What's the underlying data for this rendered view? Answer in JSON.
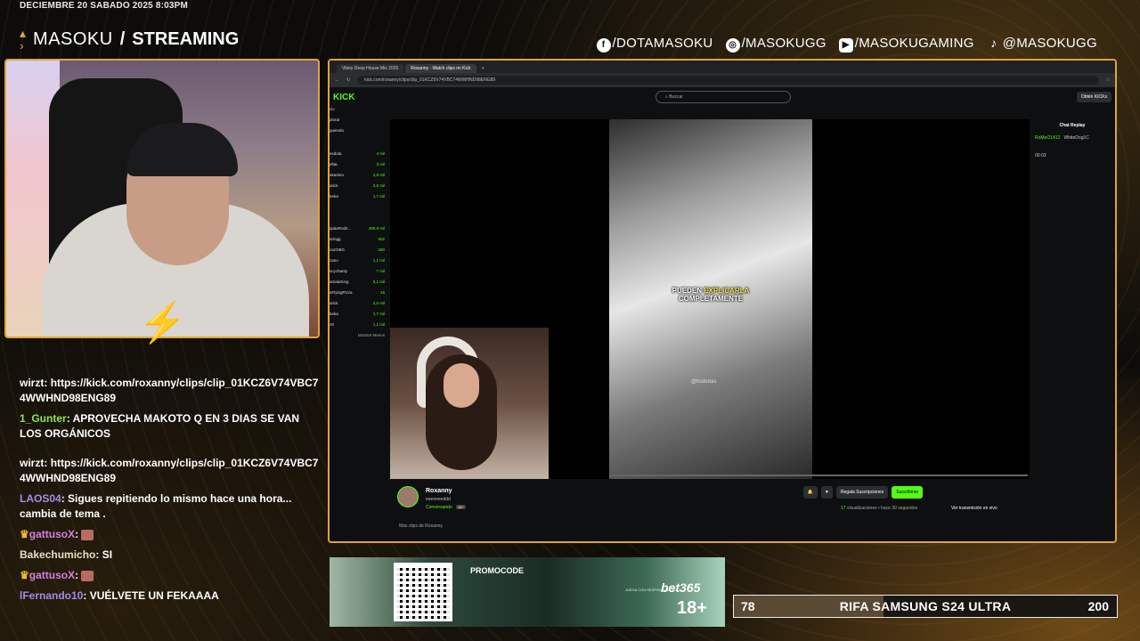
{
  "overlay": {
    "datetime": "DECIEMBRE 20 SABADO 2025 8:03PM",
    "brand_name": "MASOKU",
    "brand_sep": "/",
    "brand_tag": "STREAMING",
    "socials": [
      {
        "icon": "facebook-icon",
        "handle": "/DOTAMASOKU"
      },
      {
        "icon": "instagram-icon",
        "handle": "/MASOKUGG"
      },
      {
        "icon": "youtube-icon",
        "handle": "/MASOKUGAMING"
      },
      {
        "icon": "tiktok-icon",
        "handle": "@MASOKUGG"
      }
    ],
    "accent": "#e0a33a"
  },
  "chat": [
    {
      "user": "wirzt",
      "text": "https://kick.com/roxanny/clips/clip_01KCZ6V74VBC74WWHND98ENG89",
      "color": "#ffffff"
    },
    {
      "user": "1_Gunter",
      "text": "APROVECHA MAKOTO Q EN 3 DIAS SE VAN LOS ORGÁNICOS",
      "color": "#8fe25c"
    },
    {
      "user": "wirzt",
      "text": "https://kick.com/roxanny/clips/clip_01KCZ6V74VBC74WWHND98ENG89",
      "color": "#ffffff"
    },
    {
      "user": "LAOS04",
      "text": "Sigues repitiendo lo mismo hace una hora... cambia de tema .",
      "color": "#a38ce6"
    },
    {
      "user": "gattusoX",
      "text": "",
      "color": "#d47fe0",
      "crown": true,
      "emote": true
    },
    {
      "user": "Bakechumicho",
      "text": "SI",
      "color": "#e9dcc4"
    },
    {
      "user": "gattusoX",
      "text": "",
      "color": "#d47fe0",
      "crown": true,
      "emote": true
    },
    {
      "user": "lFernando10",
      "text": "VUÉLVETE UN FEKAAAA",
      "color": "#a28be8"
    }
  ],
  "browser": {
    "tabs": [
      "Vibey Deep House Mix 2025",
      "Roxanny - Watch clips on Kick"
    ],
    "url": "kick.com/roxanny/clips/clip_01KCZ6V74VBC74WWHND98ENG89",
    "kick_logo": "KICK",
    "search_placeholder": "Buscar",
    "get_kicks": "Obtén KICKs",
    "sidebar_nav": [
      "cio",
      "plorar",
      "guiendo"
    ],
    "sidebar_channels": [
      {
        "name": "esdota",
        "viewers": "4 mil"
      },
      {
        "name": "eltaL",
        "viewers": "3 mil"
      },
      {
        "name": "akadoto",
        "viewers": "2,8 mil"
      },
      {
        "name": "arick",
        "viewers": "2,5 mil"
      },
      {
        "name": "beka",
        "viewers": "1,7 mil"
      },
      {
        "name": "quitaRodri...",
        "viewers": "489,9 mil"
      },
      {
        "name": "aringg",
        "viewers": "502"
      },
      {
        "name": "cazOBG",
        "viewers": "280"
      },
      {
        "name": "zano",
        "viewers": "1,1 mil"
      },
      {
        "name": "scychanty",
        "viewers": "7 mil"
      },
      {
        "name": "amateKing",
        "viewers": "5,1 mil"
      },
      {
        "name": "aFlyingPizza",
        "viewers": "16"
      },
      {
        "name": "arick",
        "viewers": "2,5 mil"
      },
      {
        "name": "beka",
        "viewers": "1,7 mil"
      },
      {
        "name": "z9",
        "viewers": "1,1 mil"
      }
    ],
    "sidebar_more": "Mostrar Menos",
    "video_caption_a": "PUEDEN ",
    "video_caption_hl": "EXPLICARLA",
    "video_caption_b": "COMPLETAMENTE",
    "video_watermark": "@historias",
    "chat_replay_title": "Chat Replay",
    "chat_replay_user1": "RoMeO1412",
    "chat_replay_user2": "WhiteDog1C",
    "chat_replay_time": "00:03",
    "channel": {
      "name": "Roxanny",
      "title": "eeeeeeeddd",
      "category": "Conversando",
      "age": "18+",
      "gift_btn": "Regala Suscripciones",
      "sub_btn": "Suscribirse",
      "views": "17",
      "views_suffix": "visualizaciones • hace 30 segundos",
      "live_link": "Ver transmisión en vivo",
      "more_clips": "Más clips de Roxanny"
    }
  },
  "promo": {
    "label": "PROMOCODE",
    "brand": "bet365",
    "age": "18+",
    "disclaimer": "JUEGA CON RESPONSABILIDAD"
  },
  "raffle": {
    "title": "RIFA SAMSUNG S24 ULTRA",
    "current": "78",
    "goal": "200",
    "progress": 0.39
  }
}
